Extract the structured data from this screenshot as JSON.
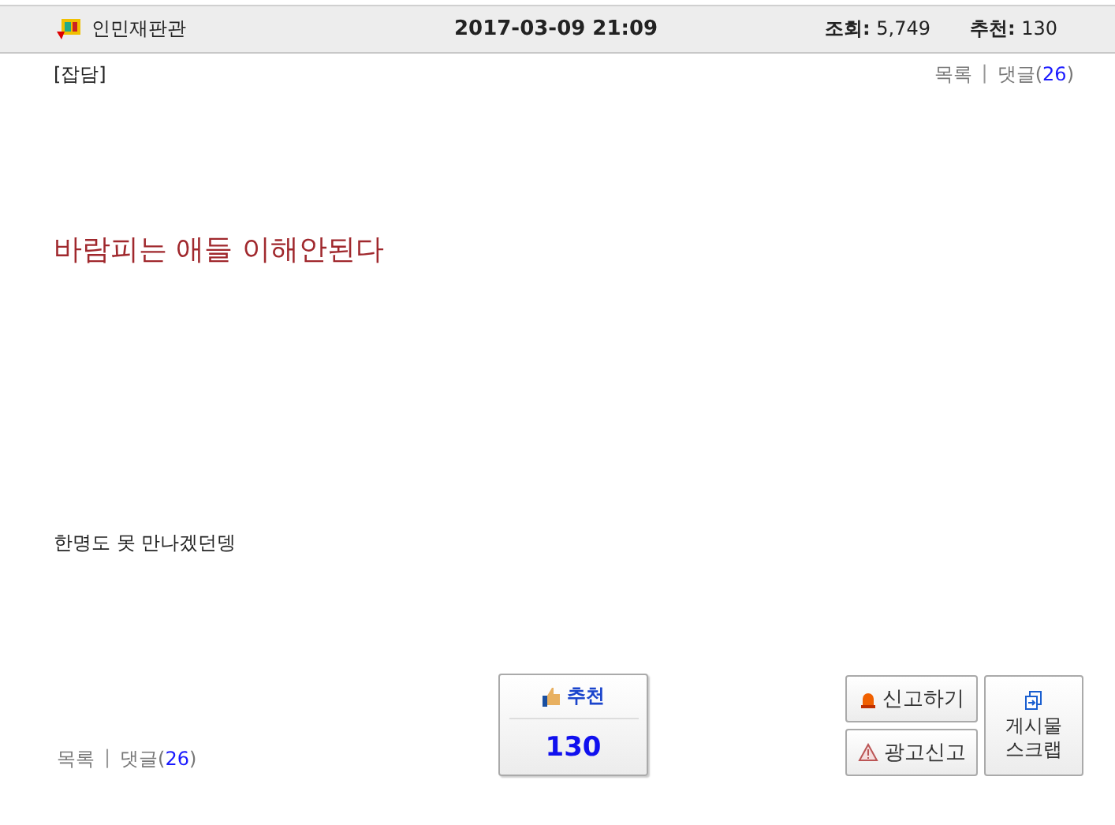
{
  "header": {
    "board": "인민재판관",
    "datetime": "2017-03-09 21:09",
    "views_label": "조회:",
    "views": "5,749",
    "recommend_label": "추천:",
    "recommend": "130"
  },
  "category": "[잡담]",
  "top_links": {
    "list": "목록",
    "separator": "|",
    "comments_open": "댓글(",
    "comments_count": "26",
    "comments_close": ")"
  },
  "title": "바람피는 애들 이해안된다",
  "body": "한명도 못 만나겠던뎅",
  "bottom_links": {
    "list": "목록",
    "separator": "|",
    "comments_open": "댓글(",
    "comments_count": "26",
    "comments_close": ")"
  },
  "recommend_button": {
    "label": "추천",
    "count": "130"
  },
  "actions": [
    {
      "kind": "report",
      "label": "신고하기"
    },
    {
      "kind": "ad",
      "label": "광고신고"
    }
  ],
  "scrap_button": {
    "line1": "게시물",
    "line2": "스크랩"
  }
}
